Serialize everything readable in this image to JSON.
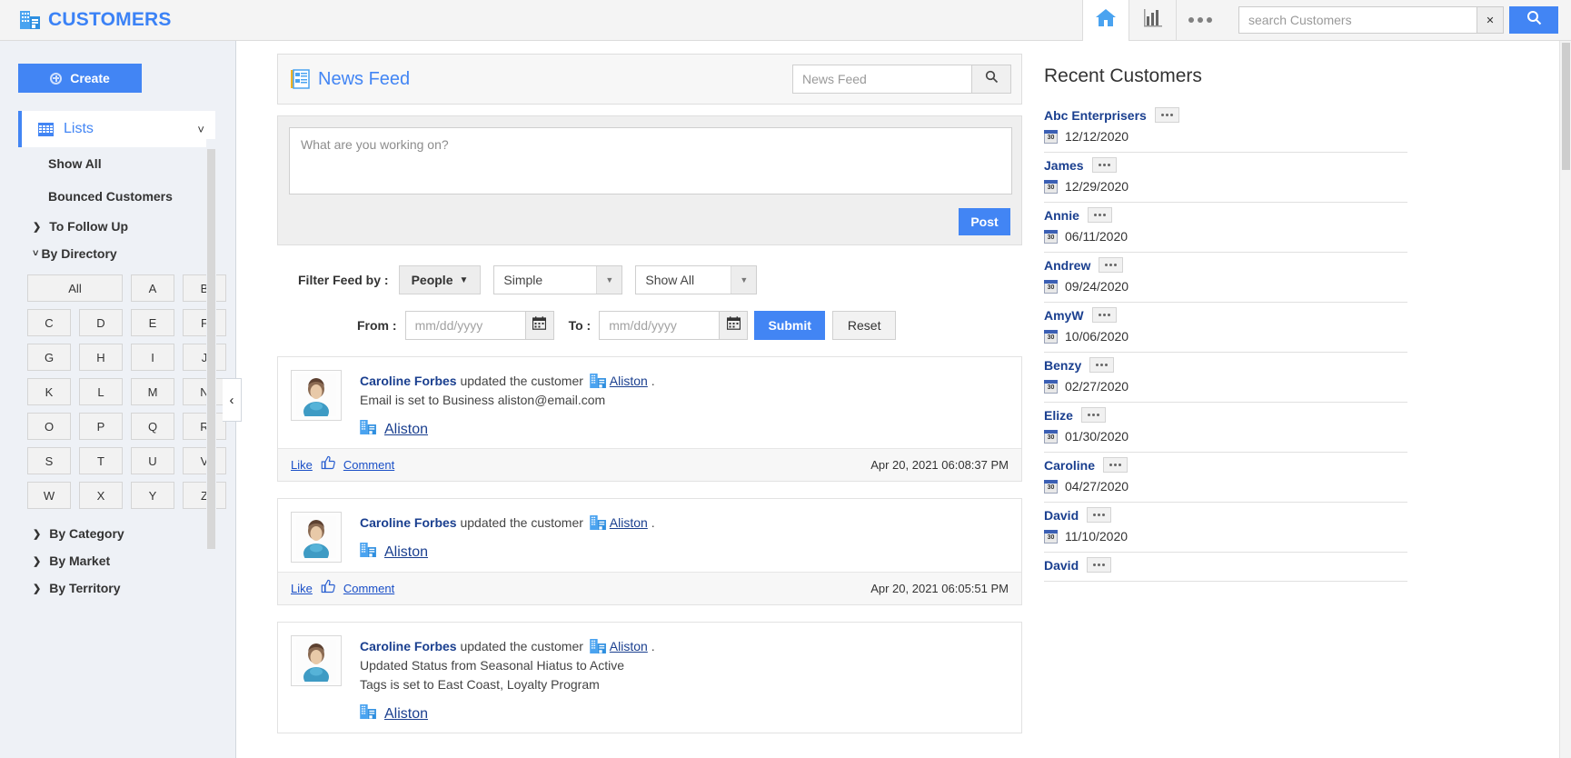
{
  "header": {
    "brand_title": "CUSTOMERS",
    "brand_icon": "building-icon",
    "home_icon": "home-icon",
    "chart_icon": "bar-chart-icon",
    "more_icon": "ellipsis-icon",
    "search_placeholder": "search Customers",
    "search_value": "",
    "search_caret_icon": "chevron-down-icon",
    "search_button_icon": "search-icon"
  },
  "sidebar": {
    "create_label": "Create",
    "lists_label": "Lists",
    "lists_icon": "grid-icon",
    "lists_chevron": "chevron-down-icon",
    "links": [
      {
        "label": "Show All"
      },
      {
        "label": "Bounced Customers"
      }
    ],
    "groups": [
      {
        "label": "To Follow Up",
        "state": "collapsed",
        "arrow": "chevron-right-icon"
      },
      {
        "label": "By Directory",
        "state": "expanded",
        "arrow": "chevron-down-icon"
      }
    ],
    "directory_letters": [
      "All",
      "A",
      "B",
      "C",
      "D",
      "E",
      "F",
      "G",
      "H",
      "I",
      "J",
      "K",
      "L",
      "M",
      "N",
      "O",
      "P",
      "Q",
      "R",
      "S",
      "T",
      "U",
      "V",
      "W",
      "X",
      "Y",
      "Z"
    ],
    "bottom_groups": [
      {
        "label": "By Category",
        "arrow": "chevron-right-icon"
      },
      {
        "label": "By Market",
        "arrow": "chevron-right-icon"
      },
      {
        "label": "By Territory",
        "arrow": "chevron-right-icon"
      }
    ],
    "collapse_handle": "‹"
  },
  "main": {
    "panel_title": "News Feed",
    "panel_icon": "news-feed-icon",
    "panel_search_placeholder": "News Feed",
    "panel_search_value": "",
    "panel_search_icon": "search-icon",
    "composer_placeholder": "What are you working on?",
    "composer_value": "",
    "post_label": "Post",
    "filter_label": "Filter Feed by :",
    "people_label": "People",
    "people_caret": "caret-down-icon",
    "simple_value": "Simple",
    "showall_value": "Show All",
    "from_label": "From :",
    "to_label": "To :",
    "date_placeholder": "mm/dd/yyyy",
    "from_value": "",
    "to_value": "",
    "calendar_icon": "calendar-icon",
    "submit_label": "Submit",
    "reset_label": "Reset",
    "like_label": "Like",
    "comment_label": "Comment",
    "thumb_icon": "thumbs-up-icon",
    "avatar_icon": "user-avatar",
    "company_icon": "building-icon"
  },
  "feed": [
    {
      "author": "Caroline Forbes",
      "action": "updated the customer",
      "target": "Aliston",
      "trailing": ".",
      "details": [
        "Email is set to Business aliston@email.com"
      ],
      "object": "Aliston",
      "timestamp": "Apr 20, 2021 06:08:37 PM"
    },
    {
      "author": "Caroline Forbes",
      "action": "updated the customer",
      "target": "Aliston",
      "trailing": ".",
      "details": [],
      "object": "Aliston",
      "timestamp": "Apr 20, 2021 06:05:51 PM"
    },
    {
      "author": "Caroline Forbes",
      "action": "updated the customer",
      "target": "Aliston",
      "trailing": ".",
      "details": [
        "Updated Status from Seasonal Hiatus to Active",
        "Tags is set to East Coast, Loyalty Program"
      ],
      "object": "Aliston",
      "timestamp": ""
    }
  ],
  "right": {
    "title": "Recent Customers",
    "customers": [
      {
        "name": "Abc Enterprisers",
        "date": "12/12/2020"
      },
      {
        "name": "James",
        "date": "12/29/2020"
      },
      {
        "name": "Annie",
        "date": "06/11/2020"
      },
      {
        "name": "Andrew",
        "date": "09/24/2020"
      },
      {
        "name": "AmyW",
        "date": "10/06/2020"
      },
      {
        "name": "Benzy",
        "date": "02/27/2020"
      },
      {
        "name": "Elize",
        "date": "01/30/2020"
      },
      {
        "name": "Caroline",
        "date": "04/27/2020"
      },
      {
        "name": "David",
        "date": "11/10/2020"
      },
      {
        "name": "David",
        "date": ""
      }
    ]
  },
  "colors": {
    "accent": "#4285f4",
    "link": "#1a3f8f",
    "sidebar_bg": "#eef1f6",
    "header_bg": "#f4f4f4"
  }
}
